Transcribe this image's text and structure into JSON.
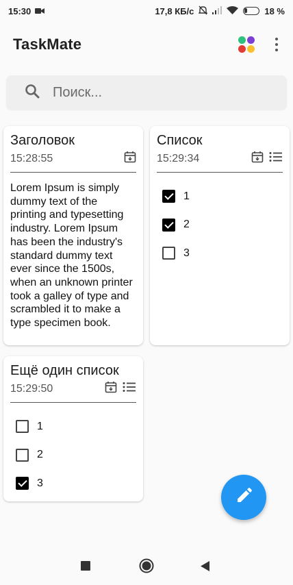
{
  "status_bar": {
    "time": "15:30",
    "speed": "17,8 КБ/с",
    "battery": "18 %"
  },
  "app": {
    "title": "TaskMate",
    "logo_colors": [
      "#2ec27e",
      "#7b3fd6",
      "#e53935",
      "#fbc02d"
    ]
  },
  "search": {
    "placeholder": "Поиск..."
  },
  "notes": [
    {
      "type": "text",
      "title": "Заголовок",
      "time": "15:28:55",
      "body": "Lorem Ipsum is simply dummy text of the printing and typesetting industry. Lorem Ipsum has been the industry's standard dummy text ever since the 1500s, when an unknown printer took a galley of type and scrambled it to make a type specimen book."
    },
    {
      "type": "list",
      "title": "Список",
      "time": "15:29:34",
      "items": [
        {
          "label": "1",
          "checked": true
        },
        {
          "label": "2",
          "checked": true
        },
        {
          "label": "3",
          "checked": false
        }
      ]
    },
    {
      "type": "list",
      "title": "Ещё один список",
      "time": "15:29:50",
      "items": [
        {
          "label": "1",
          "checked": false
        },
        {
          "label": "2",
          "checked": false
        },
        {
          "label": "3",
          "checked": true
        }
      ]
    }
  ],
  "colors": {
    "fab": "#2196f3",
    "background": "#fafafa"
  }
}
